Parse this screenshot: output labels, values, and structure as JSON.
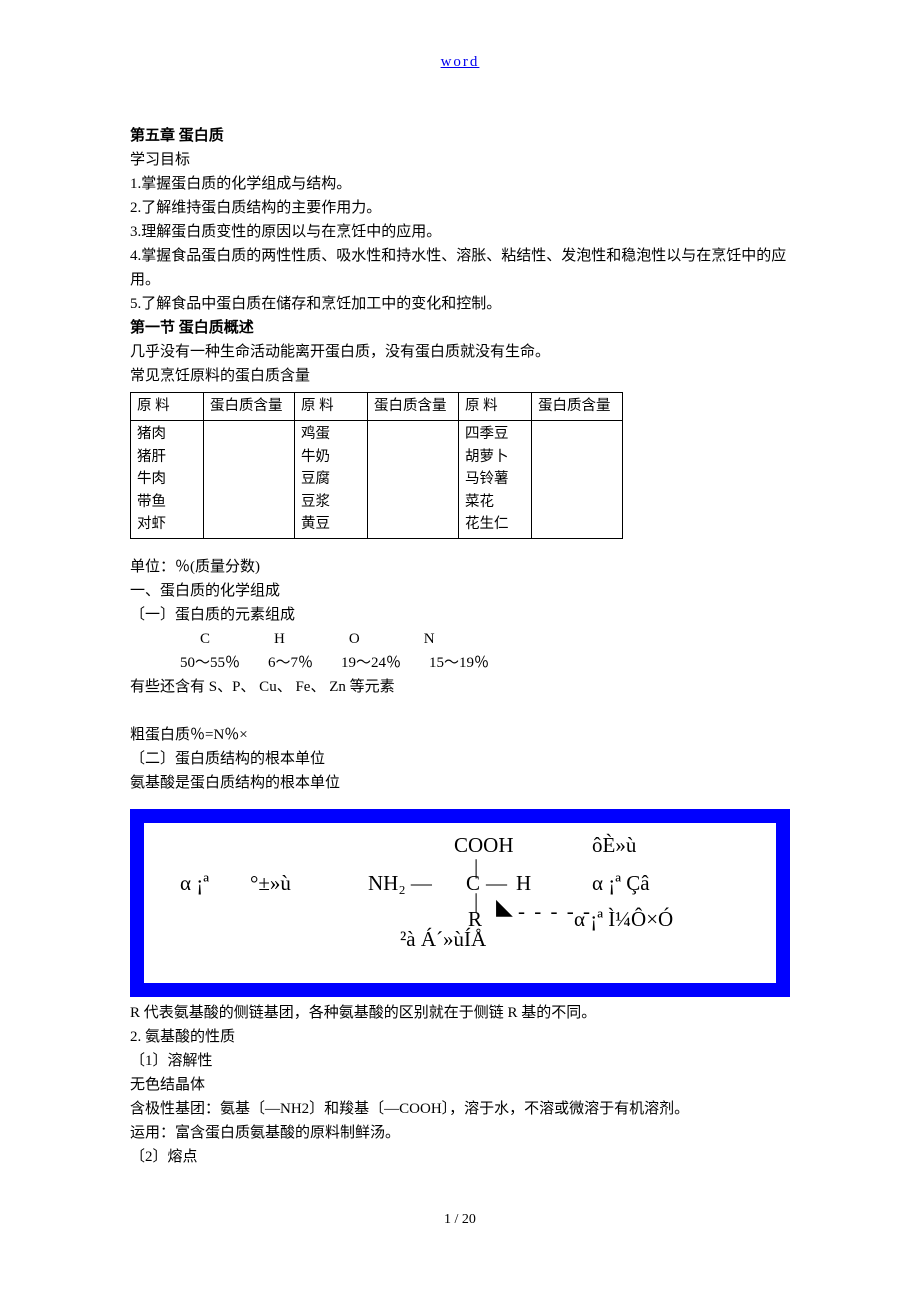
{
  "header": {
    "link": "word"
  },
  "chapter": {
    "title": "第五章 蛋白质",
    "objectives_label": "学习目标",
    "objectives": [
      "1.掌握蛋白质的化学组成与结构。",
      "2.了解维持蛋白质结构的主要作用力。",
      "3.理解蛋白质变性的原因以与在烹饪中的应用。",
      "4.掌握食品蛋白质的两性性质、吸水性和持水性、溶胀、粘结性、发泡性和稳泡性以与在烹饪中的应用。",
      "5.了解食品中蛋白质在储存和烹饪加工中的变化和控制。"
    ]
  },
  "section1": {
    "title": "第一节 蛋白质概述",
    "intro1": "几乎没有一种生命活动能离开蛋白质，没有蛋白质就没有生命。",
    "intro2": "常见烹饪原料的蛋白质含量"
  },
  "table": {
    "hdr_material": "原 料",
    "hdr_content": "蛋白质含量",
    "col1": [
      "猪肉",
      "猪肝",
      "牛肉",
      "带鱼",
      "对虾"
    ],
    "col2": [
      "鸡蛋",
      "牛奶",
      "豆腐",
      "豆浆",
      "黄豆"
    ],
    "col3": [
      "四季豆",
      "胡萝卜",
      "马铃薯",
      "菜花",
      "花生仁"
    ]
  },
  "unit_note": "单位：％(质量分数)",
  "chem": {
    "h1": "一、蛋白质的化学组成",
    "h2": "〔一〕蛋白质的元素组成",
    "elements": [
      "C",
      "H",
      "O",
      "N"
    ],
    "percents": [
      "50～55％",
      "6～7％",
      "19～24％",
      "15～19％"
    ],
    "note": " 有些还含有 S、P、 Cu、 Fe、 Zn 等元素",
    "crude": "粗蛋白质％=N％×",
    "h3": "〔二〕蛋白质结构的根本单位",
    "h3_sub": "氨基酸是蛋白质结构的根本单位"
  },
  "diagram": {
    "top_right": "ôÈ»ù",
    "cooh": "COOH",
    "alpha_left1": "α ¡ª",
    "alpha_left2": "°±»ù",
    "nh2": "NH₂ —",
    "c": "C",
    "dash": "—",
    "h": "H",
    "alpha_r1": "α ¡ª Çâ",
    "r": "R",
    "alpha_r2": "α ¡ª Ì¼Ô­×Ó",
    "bottom": "²à Á´»ùÍÅ"
  },
  "after_diagram": {
    "r_note": "R 代表氨基酸的侧链基团，各种氨基酸的区别就在于侧链 R 基的不同。",
    "h4": "2. 氨基酸的性质",
    "s1": "〔1〕溶解性",
    "s1a": "无色结晶体",
    "s1b": "含极性基团：氨基〔—NH2〕和羧基〔—COOH〕，溶于水，不溶或微溶于有机溶剂。",
    "s1c": " 运用：富含蛋白质氨基酸的原料制鲜汤。",
    "s2": "〔2〕熔点"
  },
  "footer": {
    "page": "1 / 20"
  }
}
